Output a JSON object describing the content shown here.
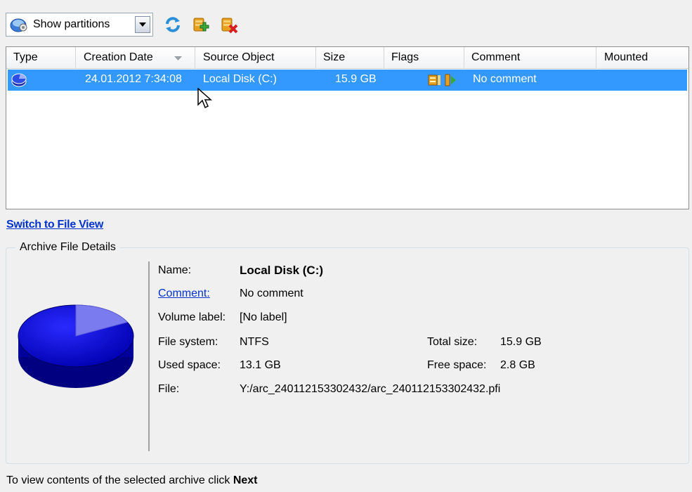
{
  "toolbar": {
    "view_select": "Show partitions",
    "icons": [
      "refresh-icon",
      "add-archive-icon",
      "delete-archive-icon"
    ]
  },
  "table": {
    "columns": [
      "Type",
      "Creation Date",
      "Source Object",
      "Size",
      "Flags",
      "Comment",
      "Mounted"
    ],
    "rows": [
      {
        "creation_date": "24.01.2012 7:34:08",
        "source_object": "Local Disk (C:)",
        "size": "15.9 GB",
        "comment": "No comment",
        "mounted": ""
      }
    ],
    "selected_row": 0,
    "sorted_column": "Creation Date"
  },
  "switch_link": "Switch to File View",
  "details": {
    "legend": "Archive File Details",
    "name_label": "Name:",
    "name_value": "Local Disk (C:)",
    "comment_label": "Comment:",
    "comment_value": "No comment",
    "volume_label_label": "Volume label:",
    "volume_label_value": "[No label]",
    "file_system_label": "File system:",
    "file_system_value": "NTFS",
    "used_space_label": "Used space:",
    "used_space_value": "13.1 GB",
    "file_label": "File:",
    "file_value": "Y:/arc_240112153302432/arc_240112153302432.pfi",
    "total_size_label": "Total size:",
    "total_size_value": "15.9 GB",
    "free_space_label": "Free space:",
    "free_space_value": "2.8 GB",
    "used_fraction": 0.824
  },
  "footer": {
    "text": "To view contents of the selected archive click",
    "bold": "Next"
  },
  "colors": {
    "selection": "#3399ff",
    "link": "#0033cc",
    "disk_used": "#0000cc",
    "disk_free": "#7b7bf0"
  }
}
